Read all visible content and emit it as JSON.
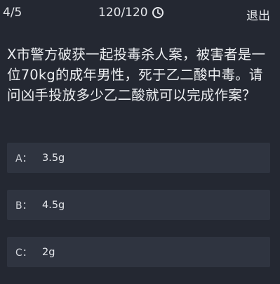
{
  "header": {
    "progress": "4/5",
    "timer": "120/120",
    "clock_icon": "clock-icon",
    "exit_label": "退出"
  },
  "question": {
    "text": "X市警方破获一起投毒杀人案，被害者是一位70kg的成年男性，死于乙二酸中毒。请问凶手投放多少乙二酸就可以完成作案？"
  },
  "options": [
    {
      "letter": "A：",
      "text": "3.5g"
    },
    {
      "letter": "B：",
      "text": "4.5g"
    },
    {
      "letter": "C：",
      "text": "2g"
    }
  ],
  "colors": {
    "background": "#242832",
    "option_background": "#2f3440",
    "text": "#e4e6ea"
  }
}
